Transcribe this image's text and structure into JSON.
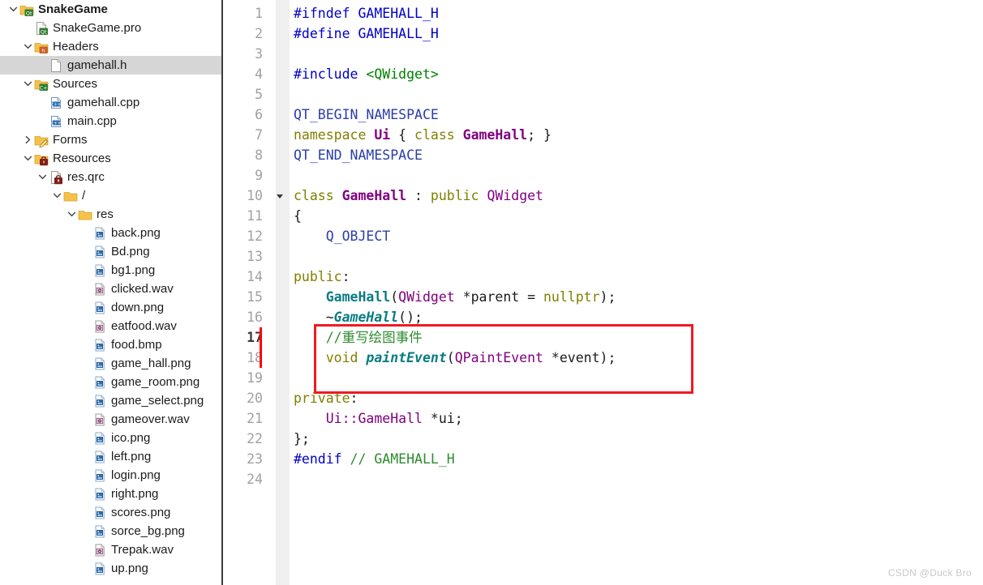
{
  "sidebar": {
    "name": "project-tree",
    "items": [
      {
        "label": "SnakeGame",
        "depth": 0,
        "chevron": "down",
        "icon": "qt-folder-icon",
        "bold": true,
        "selected": false
      },
      {
        "label": "SnakeGame.pro",
        "depth": 1,
        "chevron": "none",
        "icon": "qt-file-icon",
        "bold": false,
        "selected": false
      },
      {
        "label": "Headers",
        "depth": 1,
        "chevron": "down",
        "icon": "headers-folder-icon",
        "bold": false,
        "selected": false
      },
      {
        "label": "gamehall.h",
        "depth": 2,
        "chevron": "none",
        "icon": "header-file-icon",
        "bold": false,
        "selected": true
      },
      {
        "label": "Sources",
        "depth": 1,
        "chevron": "down",
        "icon": "sources-folder-icon",
        "bold": false,
        "selected": false
      },
      {
        "label": "gamehall.cpp",
        "depth": 2,
        "chevron": "none",
        "icon": "cpp-file-icon",
        "bold": false,
        "selected": false
      },
      {
        "label": "main.cpp",
        "depth": 2,
        "chevron": "none",
        "icon": "cpp-file-icon",
        "bold": false,
        "selected": false
      },
      {
        "label": "Forms",
        "depth": 1,
        "chevron": "right",
        "icon": "forms-folder-icon",
        "bold": false,
        "selected": false
      },
      {
        "label": "Resources",
        "depth": 1,
        "chevron": "down",
        "icon": "resources-folder-icon",
        "bold": false,
        "selected": false
      },
      {
        "label": "res.qrc",
        "depth": 2,
        "chevron": "down",
        "icon": "qrc-file-icon",
        "bold": false,
        "selected": false
      },
      {
        "label": "/",
        "depth": 3,
        "chevron": "down",
        "icon": "folder-icon",
        "bold": false,
        "selected": false
      },
      {
        "label": "res",
        "depth": 4,
        "chevron": "down",
        "icon": "folder-icon",
        "bold": false,
        "selected": false
      },
      {
        "label": "back.png",
        "depth": 5,
        "chevron": "none",
        "icon": "image-file-icon",
        "bold": false,
        "selected": false
      },
      {
        "label": "Bd.png",
        "depth": 5,
        "chevron": "none",
        "icon": "image-file-icon",
        "bold": false,
        "selected": false
      },
      {
        "label": "bg1.png",
        "depth": 5,
        "chevron": "none",
        "icon": "image-file-icon",
        "bold": false,
        "selected": false
      },
      {
        "label": "clicked.wav",
        "depth": 5,
        "chevron": "none",
        "icon": "audio-file-icon",
        "bold": false,
        "selected": false
      },
      {
        "label": "down.png",
        "depth": 5,
        "chevron": "none",
        "icon": "image-file-icon",
        "bold": false,
        "selected": false
      },
      {
        "label": "eatfood.wav",
        "depth": 5,
        "chevron": "none",
        "icon": "audio-file-icon",
        "bold": false,
        "selected": false
      },
      {
        "label": "food.bmp",
        "depth": 5,
        "chevron": "none",
        "icon": "image-file-icon",
        "bold": false,
        "selected": false
      },
      {
        "label": "game_hall.png",
        "depth": 5,
        "chevron": "none",
        "icon": "image-file-icon",
        "bold": false,
        "selected": false
      },
      {
        "label": "game_room.png",
        "depth": 5,
        "chevron": "none",
        "icon": "image-file-icon",
        "bold": false,
        "selected": false
      },
      {
        "label": "game_select.png",
        "depth": 5,
        "chevron": "none",
        "icon": "image-file-icon",
        "bold": false,
        "selected": false
      },
      {
        "label": "gameover.wav",
        "depth": 5,
        "chevron": "none",
        "icon": "audio-file-icon",
        "bold": false,
        "selected": false
      },
      {
        "label": "ico.png",
        "depth": 5,
        "chevron": "none",
        "icon": "image-file-icon",
        "bold": false,
        "selected": false
      },
      {
        "label": "left.png",
        "depth": 5,
        "chevron": "none",
        "icon": "image-file-icon",
        "bold": false,
        "selected": false
      },
      {
        "label": "login.png",
        "depth": 5,
        "chevron": "none",
        "icon": "image-file-icon",
        "bold": false,
        "selected": false
      },
      {
        "label": "right.png",
        "depth": 5,
        "chevron": "none",
        "icon": "image-file-icon",
        "bold": false,
        "selected": false
      },
      {
        "label": "scores.png",
        "depth": 5,
        "chevron": "none",
        "icon": "image-file-icon",
        "bold": false,
        "selected": false
      },
      {
        "label": "sorce_bg.png",
        "depth": 5,
        "chevron": "none",
        "icon": "image-file-icon",
        "bold": false,
        "selected": false
      },
      {
        "label": "Trepak.wav",
        "depth": 5,
        "chevron": "none",
        "icon": "audio-file-icon",
        "bold": false,
        "selected": false
      },
      {
        "label": "up.png",
        "depth": 5,
        "chevron": "none",
        "icon": "image-file-icon",
        "bold": false,
        "selected": false
      }
    ]
  },
  "editor": {
    "name": "code-editor",
    "file": "gamehall.h",
    "cursor_line": 17,
    "lines": [
      {
        "n": 1,
        "fold": false,
        "tokens": [
          {
            "t": "#ifndef GAMEHALL_H",
            "c": "t-pre"
          }
        ]
      },
      {
        "n": 2,
        "fold": false,
        "tokens": [
          {
            "t": "#define GAMEHALL_H",
            "c": "t-pre"
          }
        ]
      },
      {
        "n": 3,
        "fold": false,
        "tokens": []
      },
      {
        "n": 4,
        "fold": false,
        "tokens": [
          {
            "t": "#include ",
            "c": "t-pre"
          },
          {
            "t": "<QWidget>",
            "c": "t-str"
          }
        ]
      },
      {
        "n": 5,
        "fold": false,
        "tokens": []
      },
      {
        "n": 6,
        "fold": false,
        "tokens": [
          {
            "t": "QT_BEGIN_NAMESPACE",
            "c": "t-macro"
          }
        ]
      },
      {
        "n": 7,
        "fold": false,
        "tokens": [
          {
            "t": "namespace ",
            "c": "t-kw"
          },
          {
            "t": "Ui",
            "c": "t-cls"
          },
          {
            "t": " { ",
            "c": "t-punc"
          },
          {
            "t": "class ",
            "c": "t-kw"
          },
          {
            "t": "GameHall",
            "c": "t-cls"
          },
          {
            "t": "; }",
            "c": "t-punc"
          }
        ]
      },
      {
        "n": 8,
        "fold": false,
        "tokens": [
          {
            "t": "QT_END_NAMESPACE",
            "c": "t-macro"
          }
        ]
      },
      {
        "n": 9,
        "fold": false,
        "tokens": []
      },
      {
        "n": 10,
        "fold": true,
        "tokens": [
          {
            "t": "class ",
            "c": "t-kw"
          },
          {
            "t": "GameHall",
            "c": "t-cls"
          },
          {
            "t": " : ",
            "c": "t-punc"
          },
          {
            "t": "public ",
            "c": "t-kw"
          },
          {
            "t": "QWidget",
            "c": "t-type"
          }
        ]
      },
      {
        "n": 11,
        "fold": false,
        "tokens": [
          {
            "t": "{",
            "c": "t-punc"
          }
        ]
      },
      {
        "n": 12,
        "fold": false,
        "tokens": [
          {
            "t": "    ",
            "c": "t-plain"
          },
          {
            "t": "Q_OBJECT",
            "c": "t-macro"
          }
        ]
      },
      {
        "n": 13,
        "fold": false,
        "tokens": []
      },
      {
        "n": 14,
        "fold": false,
        "tokens": [
          {
            "t": "public",
            "c": "t-kw"
          },
          {
            "t": ":",
            "c": "t-punc"
          }
        ]
      },
      {
        "n": 15,
        "fold": false,
        "tokens": [
          {
            "t": "    ",
            "c": "t-plain"
          },
          {
            "t": "GameHall",
            "c": "t-fn"
          },
          {
            "t": "(",
            "c": "t-punc"
          },
          {
            "t": "QWidget",
            "c": "t-type"
          },
          {
            "t": " *parent = ",
            "c": "t-punc"
          },
          {
            "t": "nullptr",
            "c": "t-kw"
          },
          {
            "t": ");",
            "c": "t-punc"
          }
        ]
      },
      {
        "n": 16,
        "fold": false,
        "tokens": [
          {
            "t": "    ~",
            "c": "t-punc"
          },
          {
            "t": "GameHall",
            "c": "t-fni"
          },
          {
            "t": "();",
            "c": "t-punc"
          }
        ]
      },
      {
        "n": 17,
        "fold": false,
        "tokens": [
          {
            "t": "    //重写绘图事件",
            "c": "t-cmt"
          }
        ]
      },
      {
        "n": 18,
        "fold": false,
        "tokens": [
          {
            "t": "    ",
            "c": "t-plain"
          },
          {
            "t": "void ",
            "c": "t-kw"
          },
          {
            "t": "paintEvent",
            "c": "t-fni"
          },
          {
            "t": "(",
            "c": "t-punc"
          },
          {
            "t": "QPaintEvent",
            "c": "t-type"
          },
          {
            "t": " *event);",
            "c": "t-punc"
          }
        ]
      },
      {
        "n": 19,
        "fold": false,
        "tokens": []
      },
      {
        "n": 20,
        "fold": false,
        "tokens": [
          {
            "t": "private",
            "c": "t-kw"
          },
          {
            "t": ":",
            "c": "t-punc"
          }
        ]
      },
      {
        "n": 21,
        "fold": false,
        "tokens": [
          {
            "t": "    ",
            "c": "t-plain"
          },
          {
            "t": "Ui::GameHall",
            "c": "t-type"
          },
          {
            "t": " *ui;",
            "c": "t-punc"
          }
        ]
      },
      {
        "n": 22,
        "fold": false,
        "tokens": [
          {
            "t": "};",
            "c": "t-punc"
          }
        ]
      },
      {
        "n": 23,
        "fold": false,
        "tokens": [
          {
            "t": "#endif ",
            "c": "t-pre"
          },
          {
            "t": "// GAMEHALL_H",
            "c": "t-cmt"
          }
        ]
      },
      {
        "n": 24,
        "fold": false,
        "tokens": []
      }
    ]
  },
  "annotation": {
    "name": "red-highlight-box",
    "color": "#ee1b24"
  },
  "watermark": {
    "text": "CSDN @Duck Bro"
  }
}
